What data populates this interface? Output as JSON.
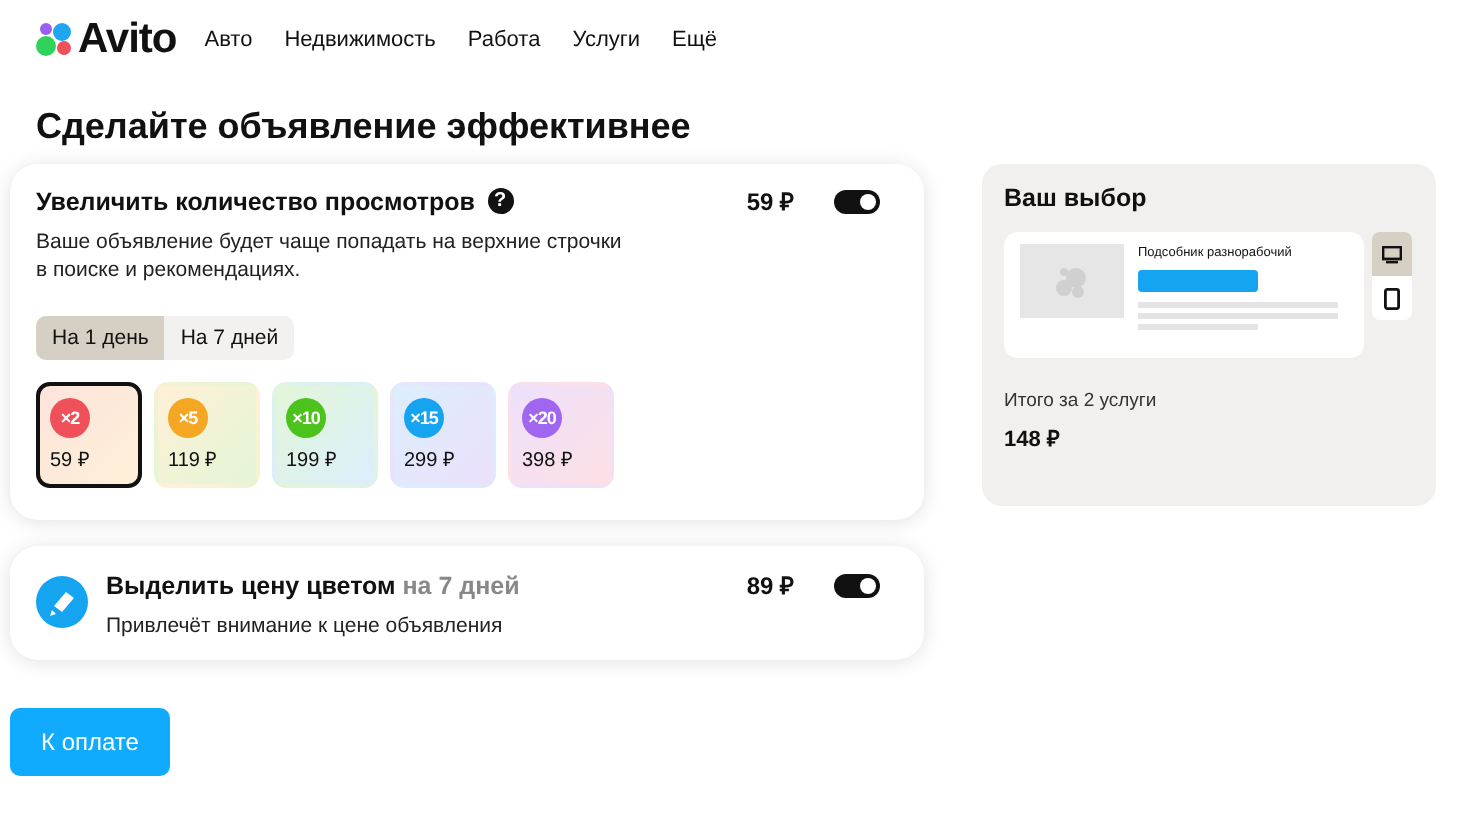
{
  "logo": {
    "text": "Avito"
  },
  "nav": [
    "Авто",
    "Недвижимость",
    "Работа",
    "Услуги",
    "Ещё"
  ],
  "title": "Сделайте объявление эффективнее",
  "services": [
    {
      "kind": "views",
      "title": "Увеличить количество просмотров",
      "help": "?",
      "price": "59 ₽",
      "on": true,
      "description": "Ваше объявление будет чаще попадать на верхние строчки в поиске и рекомендациях.",
      "tabs": [
        {
          "label": "На 1 день",
          "selected": true
        },
        {
          "label": "На 7 дней",
          "selected": false
        }
      ],
      "options": [
        {
          "badge": "×2",
          "price": "59 ₽",
          "color": "#f0505a",
          "selected": true
        },
        {
          "badge": "×5",
          "price": "119 ₽",
          "color": "#f5a623",
          "selected": false
        },
        {
          "badge": "×10",
          "price": "199 ₽",
          "color": "#4cc21c",
          "selected": false
        },
        {
          "badge": "×15",
          "price": "299 ₽",
          "color": "#14a4f0",
          "selected": false
        },
        {
          "badge": "×20",
          "price": "398 ₽",
          "color": "#a066f0",
          "selected": false
        }
      ]
    },
    {
      "kind": "color",
      "title": "Выделить цену цветом",
      "period": "на 7 дней",
      "price": "89 ₽",
      "on": true,
      "description": "Привлечёт внимание к цене объявления"
    }
  ],
  "summary": {
    "title": "Ваш выбор",
    "preview_title": "Подсобник разнорабочий",
    "devices": [
      {
        "kind": "desktop",
        "selected": true
      },
      {
        "kind": "mobile",
        "selected": false
      }
    ],
    "total_label": "Итого за 2 услуги",
    "total": "148 ₽"
  },
  "pay_button": "К оплате"
}
